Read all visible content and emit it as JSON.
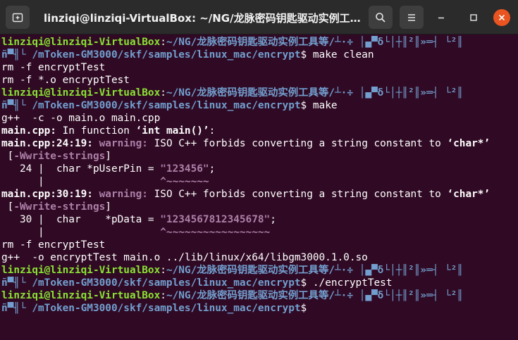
{
  "window": {
    "title": "linziqi@linziqi-VirtualBox: ~/NG/龙脉密码钥匙驱动实例工具等/...",
    "new_tab_icon": "new-tab-icon",
    "search_icon": "search-icon",
    "menu_icon": "hamburger-menu-icon"
  },
  "colors": {
    "background": "#300a24",
    "titlebar": "#2b2b2b",
    "user_host": "#8ae234",
    "path": "#729fcf",
    "warning": "#ad7fa8",
    "close_button": "#e95420"
  },
  "prompt": {
    "user": "linziqi@linziqi-VirtualBox",
    "path_start": "~/NG/龙脉密码钥匙驱动实例工具等/┴·÷ │▄▀δ└│┼║²║»═┤ └²║",
    "path_garbled": "ñ▀╢└ ",
    "path_end": "/mToken-GM3000/skf/samples/linux_mac/encrypt"
  },
  "terminal": {
    "cmd1": "make clean",
    "out1": "rm -f encryptTest",
    "out2": "rm -f *.o encryptTest",
    "cmd2": "make",
    "out3": "g++  -c -o main.o main.cpp",
    "in_function_file": "main.cpp:",
    "in_function_text": " In function ",
    "in_function_name": "‘int main()’",
    "in_function_end": ":",
    "warn1_loc": "main.cpp:24:19:",
    "warn_label": "warning:",
    "warn_text": " ISO C++ forbids converting a string constant to ",
    "warn_type": "‘char*’",
    "flag_open": " [",
    "flag": "-Wwrite-strings",
    "flag_close": "]",
    "code1_prefix": "   24 |  char *pUserPin = ",
    "code1_string": "\"123456\"",
    "code1_suffix": ";",
    "caret1_prefix": "      |                   ",
    "caret1": "^~~~~~~~",
    "warn2_loc": "main.cpp:30:19:",
    "code2_prefix": "   30 |  char    *pData = ",
    "code2_string": "\"1234567812345678\"",
    "code2_suffix": ";",
    "caret2_prefix": "      |                   ",
    "caret2": "^~~~~~~~~~~~~~~~~~",
    "out4": "rm -f encryptTest",
    "out5": "g++  -o encryptTest main.o ../lib/linux/x64/libgm3000.1.0.so",
    "cmd3": "./encryptTest",
    "cursor": ""
  }
}
